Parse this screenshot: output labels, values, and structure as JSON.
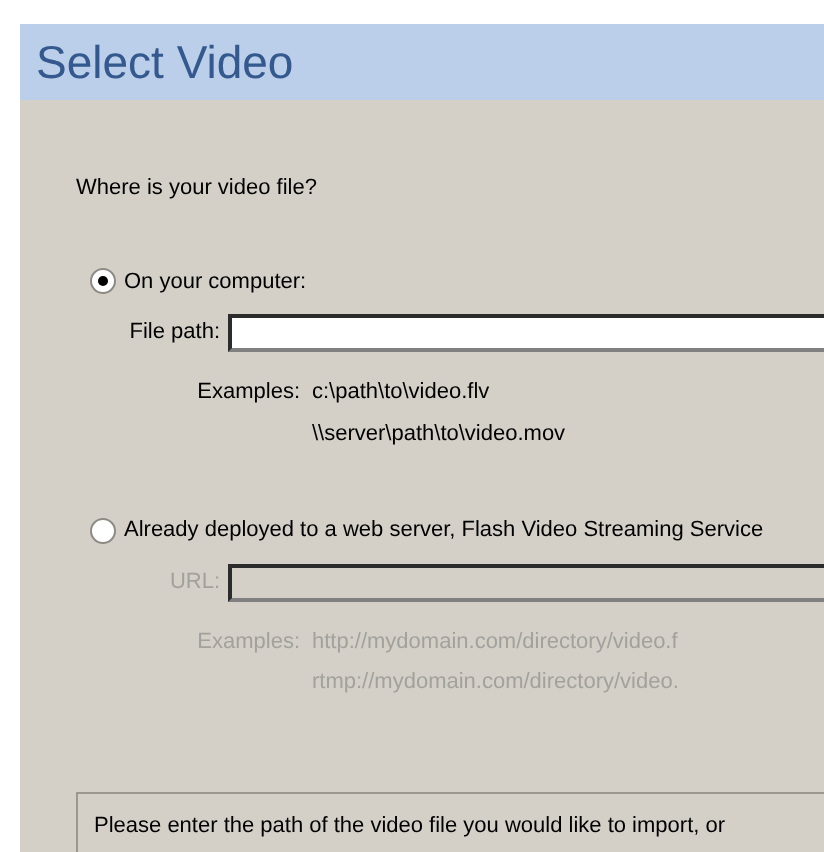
{
  "header": {
    "title": "Select Video"
  },
  "question": "Where is your video file?",
  "options": [
    {
      "label": "On your computer:",
      "selected": true,
      "disabled": false,
      "field_label": "File path:",
      "examples_label": "Examples:",
      "examples": [
        "c:\\path\\to\\video.flv",
        "\\\\server\\path\\to\\video.mov"
      ]
    },
    {
      "label": "Already deployed to a web server, Flash Video Streaming Service",
      "selected": false,
      "disabled": true,
      "field_label": "URL:",
      "examples_label": "Examples:",
      "examples": [
        "http://mydomain.com/directory/video.f",
        "rtmp://mydomain.com/directory/video."
      ]
    }
  ],
  "hint": "Please enter the path of the video file you would like to import, or"
}
